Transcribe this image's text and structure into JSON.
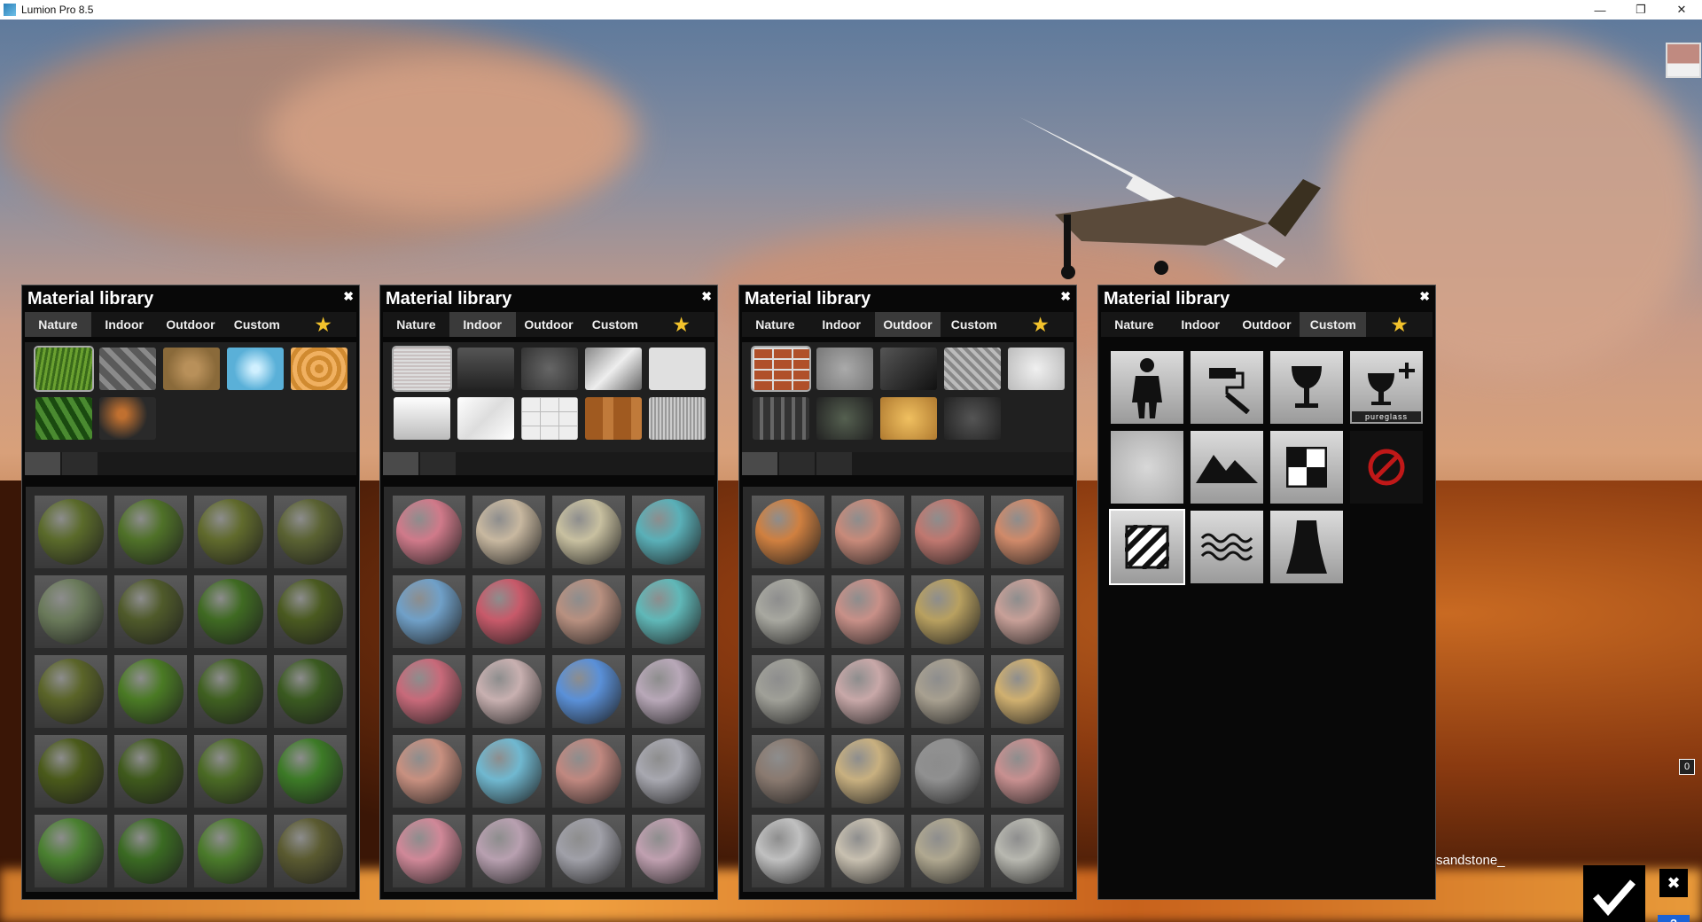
{
  "window": {
    "title": "Lumion Pro 8.5",
    "minimize": "—",
    "maximize": "❐",
    "close": "✕"
  },
  "scene": {
    "selected_material": "sandstone_",
    "zero_button": "0",
    "close_button": "✖",
    "help_button": "?"
  },
  "panels": [
    {
      "title": "Material library",
      "close": "✖",
      "active_tab": "Nature",
      "tabs": [
        "Nature",
        "Indoor",
        "Outdoor",
        "Custom",
        "★"
      ],
      "thumbnails": [
        "grass",
        "rock",
        "soil",
        "water",
        "wood",
        "forest-leaves",
        "fabric-sphere"
      ],
      "pages": 2,
      "sphere_colors": [
        "#5a6a2a",
        "#4f7128",
        "#606a2c",
        "#5a6232",
        "#6a7a5a",
        "#4f5a2a",
        "#3f6a22",
        "#4a5a20",
        "#5a6428",
        "#4a7a24",
        "#3f6020",
        "#3a5a20",
        "#4a5a1a",
        "#3f5a1c",
        "#4a6a24",
        "#3c7a26",
        "#4a8030",
        "#3a6a22",
        "#4a7a2a",
        "#5a5a30"
      ]
    },
    {
      "title": "Material library",
      "close": "✖",
      "active_tab": "Indoor",
      "tabs": [
        "Nature",
        "Indoor",
        "Outdoor",
        "Custom",
        "★"
      ],
      "thumbnails": [
        "fabric",
        "glass-dark",
        "leather",
        "metal",
        "plaster",
        "plastic",
        "marble",
        "tiles",
        "wood-floor",
        "brushed-metal"
      ],
      "pages": 2,
      "sphere_colors": [
        "#d07a8a",
        "#c8b8a0",
        "#c8c0a0",
        "#5ab0b8",
        "#70a0c8",
        "#c85a6a",
        "#b89080",
        "#60b8b8",
        "#c86a7a",
        "#c8b0b0",
        "#5a90d8",
        "#b8a8b8",
        "#c89080",
        "#70b8d0",
        "#c08880",
        "#a8a8b0",
        "#d08898",
        "#b8a0b0",
        "#a0a0a8",
        "#c0a0b0"
      ]
    },
    {
      "title": "Material library",
      "close": "✖",
      "active_tab": "Outdoor",
      "tabs": [
        "Nature",
        "Indoor",
        "Outdoor",
        "Custom",
        "★"
      ],
      "thumbnails": [
        "brick",
        "concrete",
        "glass",
        "metal-plate",
        "stucco",
        "roof-tiles",
        "gravel",
        "sandstone",
        "asphalt"
      ],
      "pages": 3,
      "sphere_colors": [
        "#d08040",
        "#c88a7a",
        "#c07870",
        "#d08a6a",
        "#a8a8a0",
        "#c89088",
        "#b8a060",
        "#c8a098",
        "#a0a098",
        "#c8a8a8",
        "#a8a090",
        "#d0b070",
        "#8a7a70",
        "#c8b080",
        "#909090",
        "#c89090",
        "#c0c0c0",
        "#c8c0b0",
        "#b0a890",
        "#b8b8b0"
      ]
    },
    {
      "title": "Material library",
      "close": "✖",
      "active_tab": "Custom",
      "tabs": [
        "Nature",
        "Indoor",
        "Outdoor",
        "Custom",
        "★"
      ],
      "custom_items": [
        "billboard",
        "color",
        "glass",
        "pureglass",
        "standard",
        "landscape",
        "chess",
        "invisible",
        "hatch",
        "water",
        "waterfall"
      ],
      "pureglass_label": "pureglass"
    }
  ]
}
